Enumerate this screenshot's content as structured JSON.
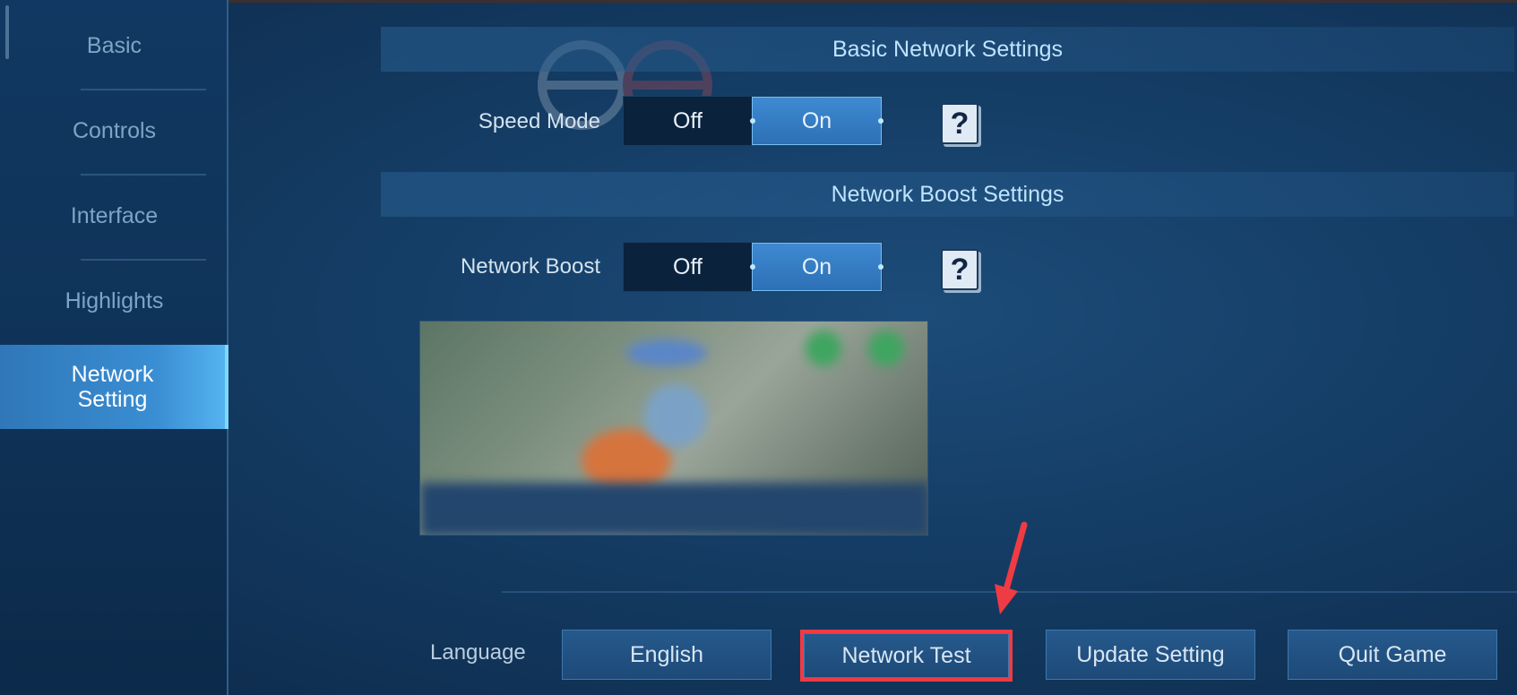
{
  "sidebar": {
    "items": [
      {
        "label": "Basic",
        "active": false
      },
      {
        "label": "Controls",
        "active": false
      },
      {
        "label": "Interface",
        "active": false
      },
      {
        "label": "Highlights",
        "active": false
      },
      {
        "label": "Network Setting",
        "active": true
      }
    ]
  },
  "sections": {
    "basic": {
      "title": "Basic Network Settings",
      "speed_mode": {
        "label": "Speed Mode",
        "off": "Off",
        "on": "On",
        "selected": "On"
      }
    },
    "boost": {
      "title": "Network Boost Settings",
      "network_boost": {
        "label": "Network Boost",
        "off": "Off",
        "on": "On",
        "selected": "On"
      }
    }
  },
  "footer": {
    "language_label": "Language",
    "buttons": {
      "english": "English",
      "network_test": "Network Test",
      "update_setting": "Update Setting",
      "quit_game": "Quit Game"
    }
  },
  "icons": {
    "help": "question-mark-icon",
    "annotation": "red-arrow-icon"
  },
  "colors": {
    "accent": "#3a8ed3",
    "highlight": "#ef3b43"
  }
}
